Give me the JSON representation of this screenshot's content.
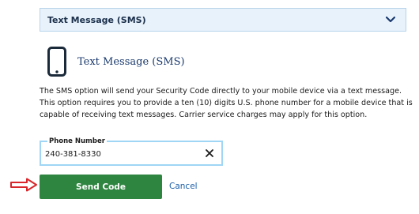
{
  "method_select": {
    "selected": "Text Message (SMS)",
    "chevron_icon": "chevron-down-icon"
  },
  "method": {
    "icon": "mobile-phone-icon",
    "title": "Text Message (SMS)",
    "description": "The SMS option will send your Security Code directly to your mobile device via a text message. This option requires you to provide a ten (10) digits U.S. phone number for a mobile device that is capable of receiving text messages. Carrier service charges may apply for this option."
  },
  "phone": {
    "label": "Phone Number",
    "value": "240-381-8330",
    "clear_icon": "close-icon"
  },
  "actions": {
    "send_label": "Send Code",
    "cancel_label": "Cancel",
    "pointer_icon": "red-arrow-icon"
  },
  "colors": {
    "accent": "#2e8540",
    "link": "#1a5ea8",
    "select_bg": "#e8f2fb",
    "arrow": "#d9262b",
    "input_border": "#9fd6f5"
  }
}
